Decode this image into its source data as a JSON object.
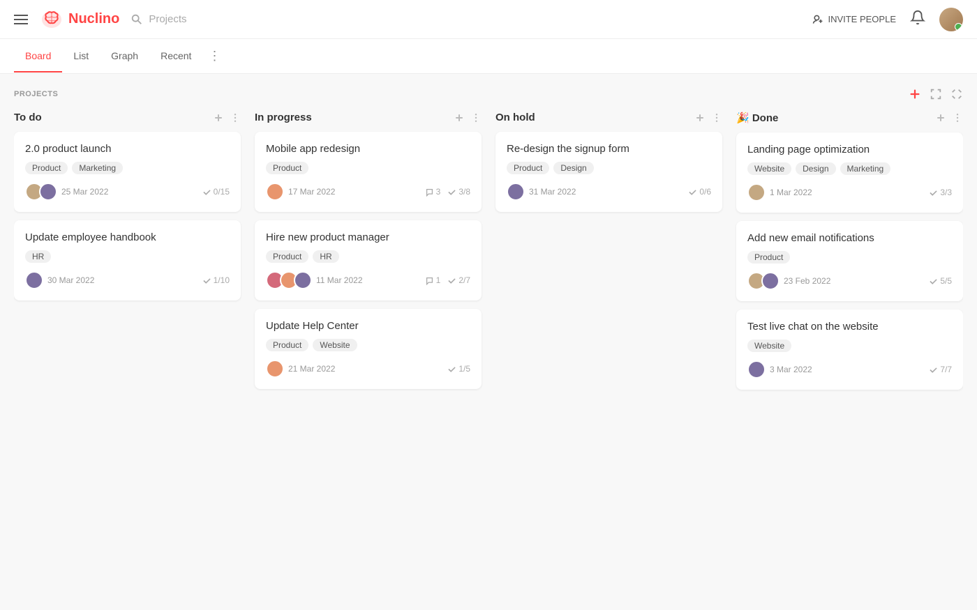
{
  "header": {
    "logo_text": "Nuclino",
    "search_placeholder": "Projects",
    "invite_label": "INVITE PEOPLE",
    "tabs": [
      {
        "id": "board",
        "label": "Board",
        "active": true
      },
      {
        "id": "list",
        "label": "List",
        "active": false
      },
      {
        "id": "graph",
        "label": "Graph",
        "active": false
      },
      {
        "id": "recent",
        "label": "Recent",
        "active": false
      }
    ],
    "tab_more": "⋮"
  },
  "projects_label": "PROJECTS",
  "add_icon": "+",
  "columns": [
    {
      "id": "todo",
      "title": "To do",
      "emoji": "",
      "cards": [
        {
          "id": "card-1",
          "title": "2.0 product launch",
          "tags": [
            "Product",
            "Marketing"
          ],
          "avatars": [
            "tan",
            "purple"
          ],
          "date": "25 Mar 2022",
          "checks": "0/15",
          "comments": null
        },
        {
          "id": "card-2",
          "title": "Update employee handbook",
          "tags": [
            "HR"
          ],
          "avatars": [
            "purple"
          ],
          "date": "30 Mar 2022",
          "checks": "1/10",
          "comments": null
        }
      ]
    },
    {
      "id": "inprogress",
      "title": "In progress",
      "emoji": "",
      "cards": [
        {
          "id": "card-3",
          "title": "Mobile app redesign",
          "tags": [
            "Product"
          ],
          "avatars": [
            "orange"
          ],
          "date": "17 Mar 2022",
          "checks": "3/8",
          "comments": "3"
        },
        {
          "id": "card-4",
          "title": "Hire new product manager",
          "tags": [
            "Product",
            "HR"
          ],
          "avatars": [
            "pink",
            "orange",
            "purple"
          ],
          "date": "11 Mar 2022",
          "checks": "2/7",
          "comments": "1"
        },
        {
          "id": "card-5",
          "title": "Update Help Center",
          "tags": [
            "Product",
            "Website"
          ],
          "avatars": [
            "orange"
          ],
          "date": "21 Mar 2022",
          "checks": "1/5",
          "comments": null
        }
      ]
    },
    {
      "id": "onhold",
      "title": "On hold",
      "emoji": "",
      "cards": [
        {
          "id": "card-6",
          "title": "Re-design the signup form",
          "tags": [
            "Product",
            "Design"
          ],
          "avatars": [
            "purple"
          ],
          "date": "31 Mar 2022",
          "checks": "0/6",
          "comments": null
        }
      ]
    },
    {
      "id": "done",
      "title": "Done",
      "emoji": "🎉",
      "cards": [
        {
          "id": "card-7",
          "title": "Landing page optimization",
          "tags": [
            "Website",
            "Design",
            "Marketing"
          ],
          "avatars": [
            "tan"
          ],
          "date": "1 Mar 2022",
          "checks": "3/3",
          "comments": null
        },
        {
          "id": "card-8",
          "title": "Add new email notifications",
          "tags": [
            "Product"
          ],
          "avatars": [
            "tan",
            "purple"
          ],
          "date": "23 Feb 2022",
          "checks": "5/5",
          "comments": null
        },
        {
          "id": "card-9",
          "title": "Test live chat on the website",
          "tags": [
            "Website"
          ],
          "avatars": [
            "purple"
          ],
          "date": "3 Mar 2022",
          "checks": "7/7",
          "comments": null
        }
      ]
    }
  ]
}
